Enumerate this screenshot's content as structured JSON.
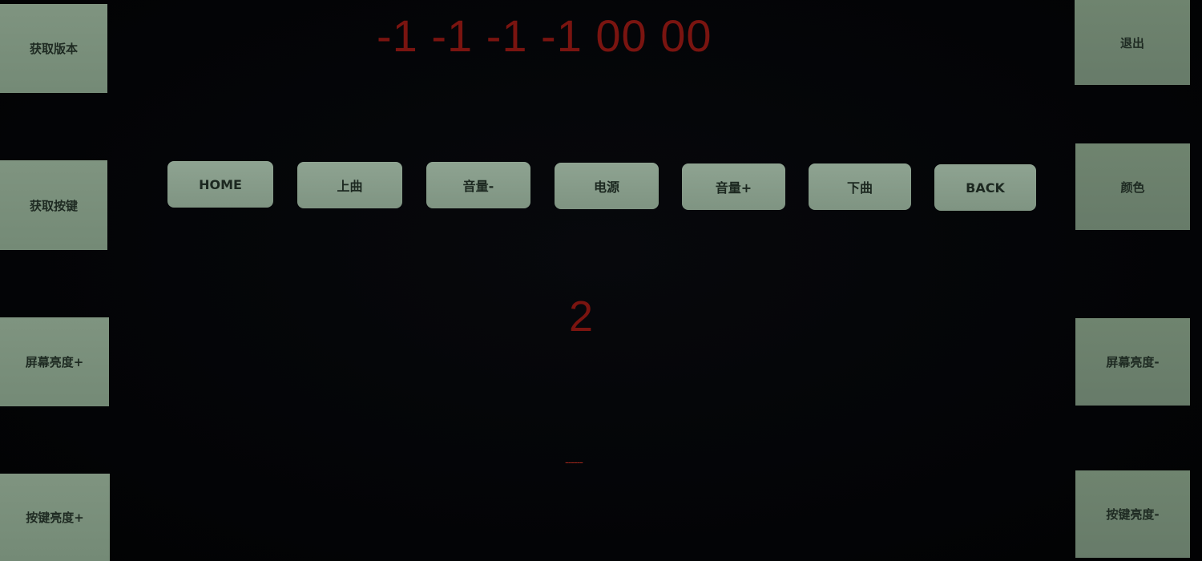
{
  "display": {
    "time_text": "-1 -1 -1 -1 00 00",
    "key_code": "2",
    "dash_text": "------"
  },
  "left_panel": {
    "get_version": "获取版本",
    "get_key": "获取按键",
    "screen_brightness_up": "屏幕亮度+",
    "key_brightness_up": "按键亮度+"
  },
  "right_panel": {
    "exit": "退出",
    "color": "颜色",
    "screen_brightness_down": "屏幕亮度-",
    "key_brightness_down": "按键亮度-"
  },
  "key_row": {
    "home": "HOME",
    "prev_track": "上曲",
    "volume_down": "音量-",
    "power": "电源",
    "volume_up": "音量+",
    "next_track": "下曲",
    "back": "BACK"
  },
  "colors": {
    "background": "#040508",
    "button": "#7f9480",
    "text_display": "#7a1410"
  }
}
